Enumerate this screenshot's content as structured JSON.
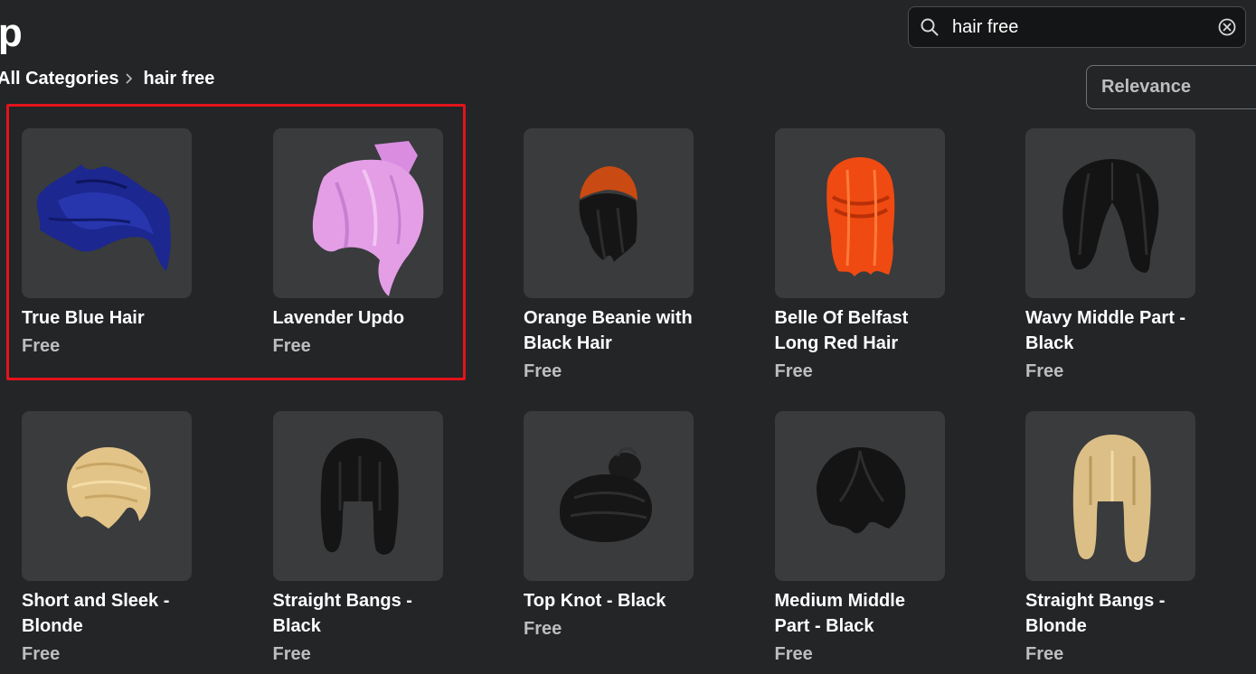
{
  "header": {
    "title": "op"
  },
  "search": {
    "value": "hair free"
  },
  "breadcrumb": {
    "root": "All Categories",
    "current": "hair free"
  },
  "sort": {
    "selected": "Relevance"
  },
  "items": [
    {
      "name": "True Blue Hair",
      "price": "Free",
      "icon": "blue-hair-icon",
      "color": "#1d2a8c"
    },
    {
      "name": "Lavender Updo",
      "price": "Free",
      "icon": "lavender-updo-icon",
      "color": "#e39ee6"
    },
    {
      "name": "Orange Beanie with Black Hair",
      "price": "Free",
      "icon": "orange-beanie-hair-icon",
      "color": "#c94a12"
    },
    {
      "name": "Belle Of Belfast Long Red Hair",
      "price": "Free",
      "icon": "long-red-hair-icon",
      "color": "#ef4a12"
    },
    {
      "name": "Wavy Middle Part - Black",
      "price": "Free",
      "icon": "wavy-black-hair-icon",
      "color": "#141414"
    },
    {
      "name": "Short and Sleek - Blonde",
      "price": "Free",
      "icon": "short-blonde-hair-icon",
      "color": "#e2c488"
    },
    {
      "name": "Straight Bangs - Black",
      "price": "Free",
      "icon": "straight-bangs-black-icon",
      "color": "#151515"
    },
    {
      "name": "Top Knot - Black",
      "price": "Free",
      "icon": "top-knot-black-icon",
      "color": "#161616"
    },
    {
      "name": "Medium Middle Part - Black",
      "price": "Free",
      "icon": "medium-middle-part-black-icon",
      "color": "#141414"
    },
    {
      "name": "Straight Bangs - Blonde",
      "price": "Free",
      "icon": "straight-bangs-blonde-icon",
      "color": "#dbbf86"
    }
  ],
  "colors": {
    "background": "#232527",
    "card": "#393b3d",
    "highlight": "#e3131b",
    "muted_text": "#bdbebe"
  }
}
